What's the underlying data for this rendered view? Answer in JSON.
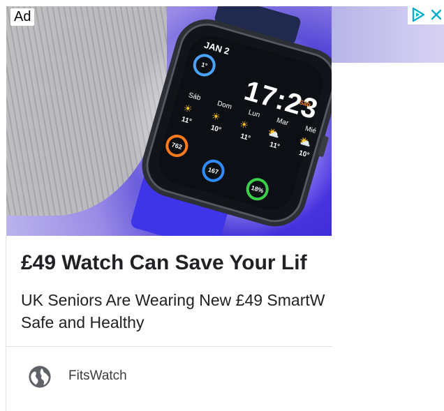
{
  "ad": {
    "label": "Ad",
    "headline": "£49 Watch Can Save Your Lif",
    "body_line1": "UK Seniors Are Wearing New £49 SmartW",
    "body_line2": "Safe and Healthy",
    "advertiser": "FitsWatch",
    "adchoices_icon": "adchoices-icon",
    "close_icon": "close-icon",
    "advertiser_icon": "globe-icon"
  },
  "watch_face": {
    "date": "JAN 2",
    "time": "17:23",
    "day_tag": "Sáb",
    "temp_ring": "1°",
    "days": [
      "Sáb",
      "Dom",
      "Lun",
      "Mar",
      "Mié"
    ],
    "temps": [
      "11°",
      "10°",
      "11°",
      "11°",
      "10°"
    ],
    "steps": "762",
    "pai": "167",
    "battery": "18%"
  },
  "colors": {
    "adchoices_accent": "#00aecd",
    "text_primary": "#202124",
    "divider": "#e0e0e0",
    "icon_gray": "#5f6368"
  }
}
